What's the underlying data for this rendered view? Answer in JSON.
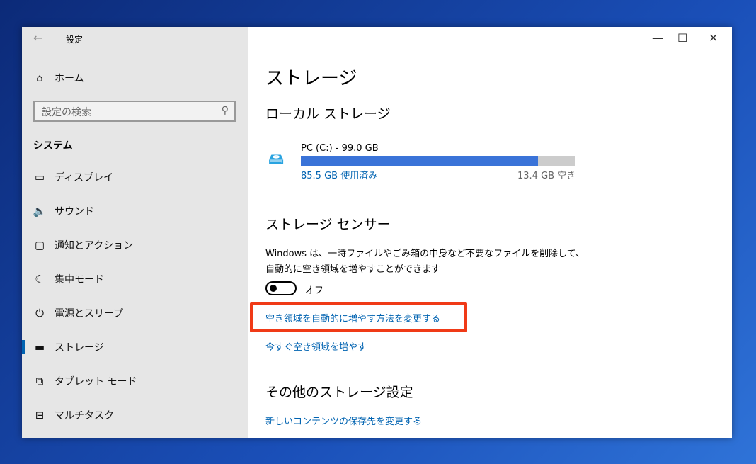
{
  "window": {
    "title": "設定",
    "back": "←",
    "minimize": "—",
    "maximize": "☐",
    "close": "✕"
  },
  "sidebar": {
    "home": "ホーム",
    "search_placeholder": "設定の検索",
    "section": "システム",
    "items": [
      {
        "label": "ディスプレイ",
        "icon": "monitor-icon"
      },
      {
        "label": "サウンド",
        "icon": "speaker-icon"
      },
      {
        "label": "通知とアクション",
        "icon": "notification-icon"
      },
      {
        "label": "集中モード",
        "icon": "moon-icon"
      },
      {
        "label": "電源とスリープ",
        "icon": "power-icon"
      },
      {
        "label": "ストレージ",
        "icon": "storage-icon",
        "selected": true
      },
      {
        "label": "タブレット モード",
        "icon": "tablet-icon"
      },
      {
        "label": "マルチタスク",
        "icon": "multitask-icon"
      }
    ]
  },
  "main": {
    "title": "ストレージ",
    "local_heading": "ローカル ストレージ",
    "drive": {
      "name": "PC (C:) - 99.0 GB",
      "used": "85.5 GB 使用済み",
      "free": "13.4 GB 空き",
      "used_fraction": 0.864
    },
    "sense_heading": "ストレージ センサー",
    "sense_desc1": "Windows は、一時ファイルやごみ箱の中身など不要なファイルを削除して、",
    "sense_desc2": "自動的に空き領域を増やすことができます",
    "toggle_label": "オフ",
    "toggle_on": false,
    "link_change": "空き領域を自動的に増やす方法を変更する",
    "link_free_now": "今すぐ空き領域を増やす",
    "other_heading": "その他のストレージ設定",
    "link_new_content": "新しいコンテンツの保存先を変更する"
  },
  "colors": {
    "accent": "#0063b1",
    "highlight": "#f03a17",
    "bar": "#3a73d8"
  }
}
